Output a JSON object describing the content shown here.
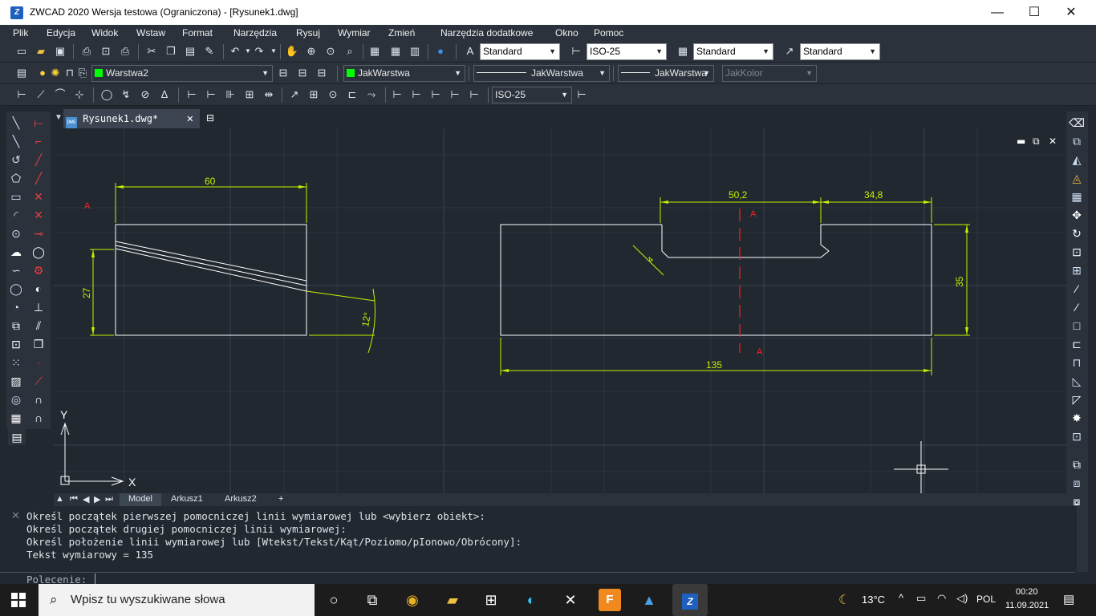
{
  "window": {
    "title": "ZWCAD 2020 Wersja testowa (Ograniczona) - [Rysunek1.dwg]",
    "minimize": "—",
    "maximize": "☐",
    "close": "✕"
  },
  "menu": [
    "Plik",
    "Edycja",
    "Widok",
    "Wstaw",
    "Format",
    "Narzędzia",
    "Rysuj",
    "Wymiar",
    "Zmień",
    "Narzędzia dodatkowe",
    "Okno",
    "Pomoc"
  ],
  "toolbar1": {
    "text_style": "Standard",
    "dim_style": "ISO-25",
    "table_style": "Standard",
    "mleader_style": "Standard"
  },
  "toolbar2": {
    "layer": "Warstwa2",
    "color": "JakWarstwa",
    "linetype": "JakWarstwa",
    "lineweight": "JakWarstwa",
    "plotstyle": "JakKolor"
  },
  "toolbar3": {
    "dim_style": "ISO-25"
  },
  "document": {
    "tab_label": "Rysunek1.dwg*",
    "tab_icon": "DWG"
  },
  "drawing": {
    "label_a_left": "A",
    "dim_60": "60",
    "dim_27": "27",
    "dim_12deg": "12°",
    "dim_50_2": "50,2",
    "dim_34_8": "34,8",
    "dim_35": "35",
    "dim_135": "135",
    "dim_4": "4",
    "label_a_top": "A",
    "label_a_bottom": "A",
    "ucs_x": "X",
    "ucs_y": "Y"
  },
  "layout_tabs": {
    "model": "Model",
    "sheet1": "Arkusz1",
    "sheet2": "Arkusz2",
    "add": "+"
  },
  "command": {
    "lines": [
      "Określ początek pierwszej pomocniczej linii wymiarowej lub <wybierz obiekt>:",
      "Określ początek drugiej pomocniczej linii wymiarowej:",
      "Określ położenie linii wymiarowej lub [Wtekst/Tekst/Kąt/Poziomo/pIonowo/Obrócony]:",
      "Tekst wymiarowy = 135"
    ],
    "prompt": "Polecenie:"
  },
  "taskbar": {
    "search_placeholder": "Wpisz tu wyszukiwane słowa",
    "weather": "13°C",
    "language": "POL",
    "time": "00:20",
    "date": "11.09.2021"
  },
  "colors": {
    "dim": "#c8f000",
    "red": "#ff0000",
    "geometry": "#ffffff",
    "panel": "#2b323c",
    "canvas": "#212830"
  }
}
